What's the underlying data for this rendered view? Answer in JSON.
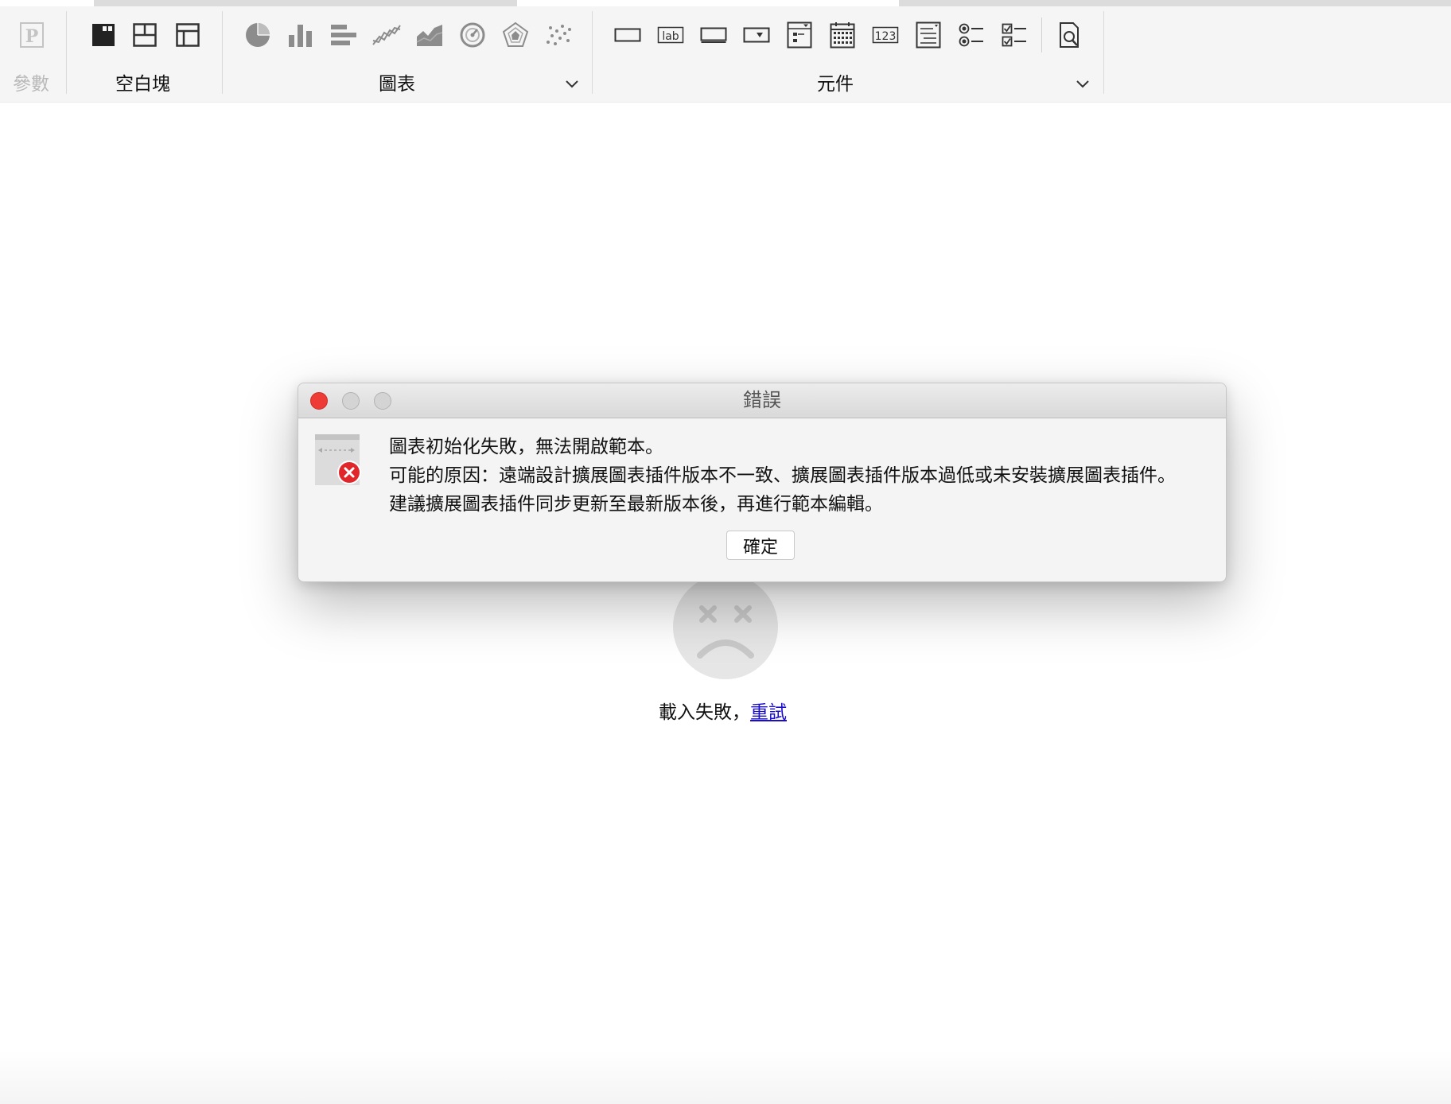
{
  "toolbar": {
    "param_group": {
      "label": "參數",
      "icon": "parameter-p-icon"
    },
    "blank_group": {
      "label": "空白塊",
      "items": [
        "absolute-layout-block-icon",
        "split-layout-block-icon",
        "tab-layout-block-icon"
      ]
    },
    "chart_group": {
      "label": "圖表",
      "items": [
        "pie-chart-icon",
        "column-chart-icon",
        "bar-chart-icon",
        "line-chart-icon",
        "area-chart-icon",
        "gauge-chart-icon",
        "radar-chart-icon",
        "scatter-chart-icon"
      ],
      "expand_icon": "chevron-down-icon"
    },
    "widget_group": {
      "label": "元件",
      "items": [
        "text-field-icon",
        "label-icon",
        "button-icon",
        "dropdown-icon",
        "dropdown-tree-icon",
        "date-picker-icon",
        "number-field-icon",
        "text-area-icon",
        "radio-group-icon",
        "checkbox-group-icon",
        "query-button-icon"
      ],
      "expand_icon": "chevron-down-icon"
    }
  },
  "background": {
    "fail_text": "載入失敗，",
    "retry_link": "重試"
  },
  "dialog": {
    "title": "錯誤",
    "lines": [
      "圖表初始化失敗，無法開啟範本。",
      "可能的原因：遠端設計擴展圖表插件版本不一致、擴展圖表插件版本過低或未安裝擴展圖表插件。",
      "建議擴展圖表插件同步更新至最新版本後，再進行範本編輯。"
    ],
    "ok_label": "確定"
  },
  "colors": {
    "toolbar_bg": "#f5f5f5",
    "close_light": "#ee3b35",
    "error_badge": "#e0262b",
    "link": "#1a0dcc"
  }
}
